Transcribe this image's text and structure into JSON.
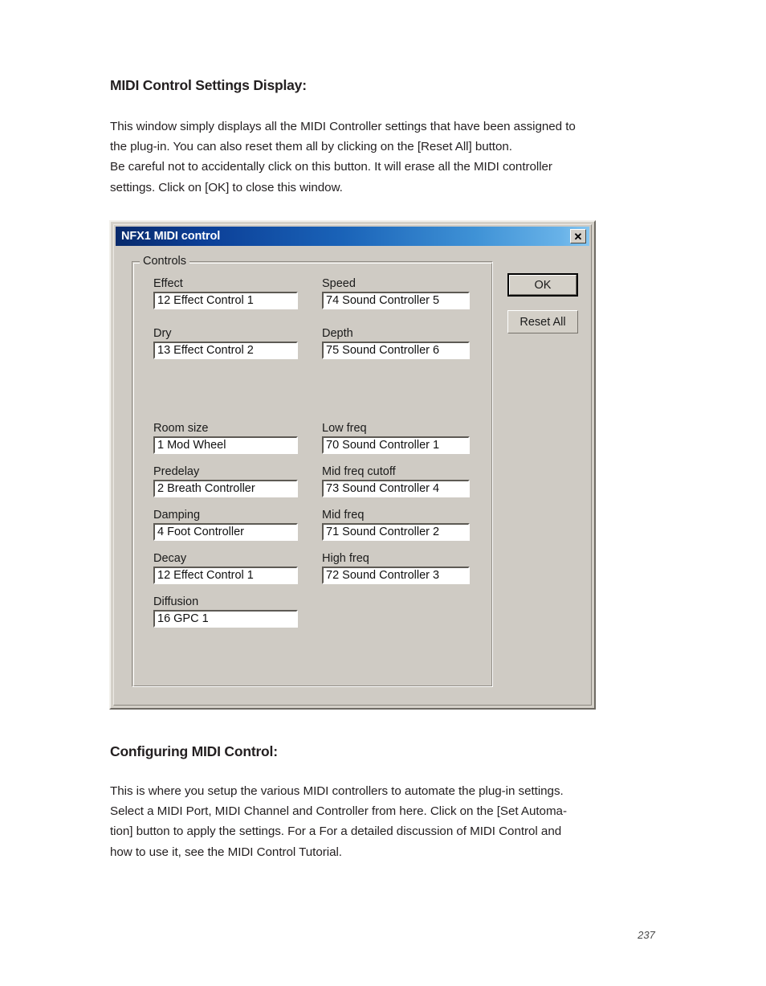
{
  "document": {
    "section1": {
      "heading": "MIDI Control Settings Display:",
      "paragraph_line1": "This window simply displays all the MIDI Controller settings that have been assigned to",
      "paragraph_line2": "the plug-in.  You can also reset them all by clicking on the [Reset All] button.",
      "paragraph_line3": "Be careful not to accidentally click on this button.  It will erase all the MIDI controller",
      "paragraph_line4": "settings.  Click on [OK] to close this window."
    },
    "section2": {
      "heading": "Configuring MIDI Control:",
      "paragraph_line1": "This is where you setup the various MIDI controllers to automate the plug-in settings.",
      "paragraph_line2": "Select a MIDI Port, MIDI Channel and Controller from here.  Click on the [Set Automa-",
      "paragraph_line3": "tion] button to apply the settings.  For a For a detailed discussion of MIDI Control and",
      "paragraph_line4": "how to use it, see the MIDI Control Tutorial."
    },
    "page_number": "237"
  },
  "dialog": {
    "title": "NFX1 MIDI control",
    "close_icon": "close-icon",
    "close_glyph": "✕",
    "groupbox_legend": "Controls",
    "buttons": {
      "ok": "OK",
      "reset_all": "Reset All"
    },
    "fields": {
      "effect": {
        "label": "Effect",
        "value": "12 Effect Control 1"
      },
      "dry": {
        "label": "Dry",
        "value": "13 Effect Control 2"
      },
      "speed": {
        "label": "Speed",
        "value": "74 Sound Controller 5"
      },
      "depth": {
        "label": "Depth",
        "value": "75 Sound Controller 6"
      },
      "room_size": {
        "label": "Room size",
        "value": "1 Mod Wheel"
      },
      "predelay": {
        "label": "Predelay",
        "value": "2 Breath Controller"
      },
      "damping": {
        "label": "Damping",
        "value": "4 Foot Controller"
      },
      "decay": {
        "label": "Decay",
        "value": "12 Effect Control 1"
      },
      "diffusion": {
        "label": "Diffusion",
        "value": "16 GPC 1"
      },
      "low_freq": {
        "label": "Low freq",
        "value": "70 Sound Controller 1"
      },
      "mid_freq_cutoff": {
        "label": "Mid freq cutoff",
        "value": "73 Sound Controller 4"
      },
      "mid_freq": {
        "label": "Mid freq",
        "value": "71 Sound Controller 2"
      },
      "high_freq": {
        "label": "High freq",
        "value": "72 Sound Controller 3"
      }
    }
  },
  "colors": {
    "titlebar_start": "#082a6b",
    "titlebar_end": "#86c6f0",
    "dialog_face": "#cfcbc4",
    "field_background": "#ffffff",
    "text": "#231f20"
  }
}
